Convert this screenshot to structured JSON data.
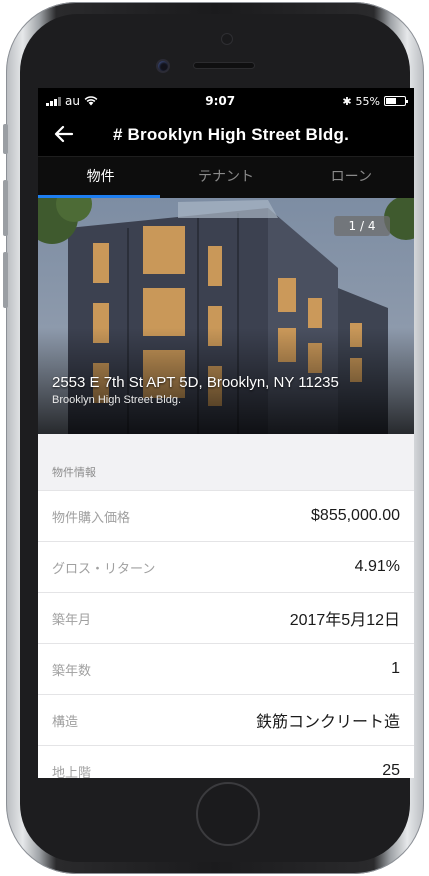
{
  "status_bar": {
    "carrier": "au",
    "time": "9:07",
    "bluetooth_symbol": "✱",
    "battery": "55%",
    "battery_level": 0.55
  },
  "nav": {
    "title": "# Brooklyn High Street Bldg."
  },
  "tabs": [
    {
      "label": "物件",
      "active": true
    },
    {
      "label": "テナント",
      "active": false
    },
    {
      "label": "ローン",
      "active": false
    }
  ],
  "hero": {
    "pager": "1 / 4",
    "address": "2553 E 7th St APT 5D, Brooklyn, NY 11235",
    "building": "Brooklyn High Street Bldg."
  },
  "info": {
    "section_title": "物件情報",
    "rows": [
      {
        "label": "物件購入価格",
        "value": "$855,000.00"
      },
      {
        "label": "グロス・リターン",
        "value": "4.91%"
      },
      {
        "label": "築年月",
        "value": "2017年5月12日"
      },
      {
        "label": "築年数",
        "value": "1"
      },
      {
        "label": "構造",
        "value": "鉄筋コンクリート造"
      },
      {
        "label": "地上階",
        "value": "25"
      }
    ]
  },
  "colors": {
    "accent": "#1e7ef0",
    "nav_bg": "#000000",
    "section_bg": "#f2f2f4"
  }
}
